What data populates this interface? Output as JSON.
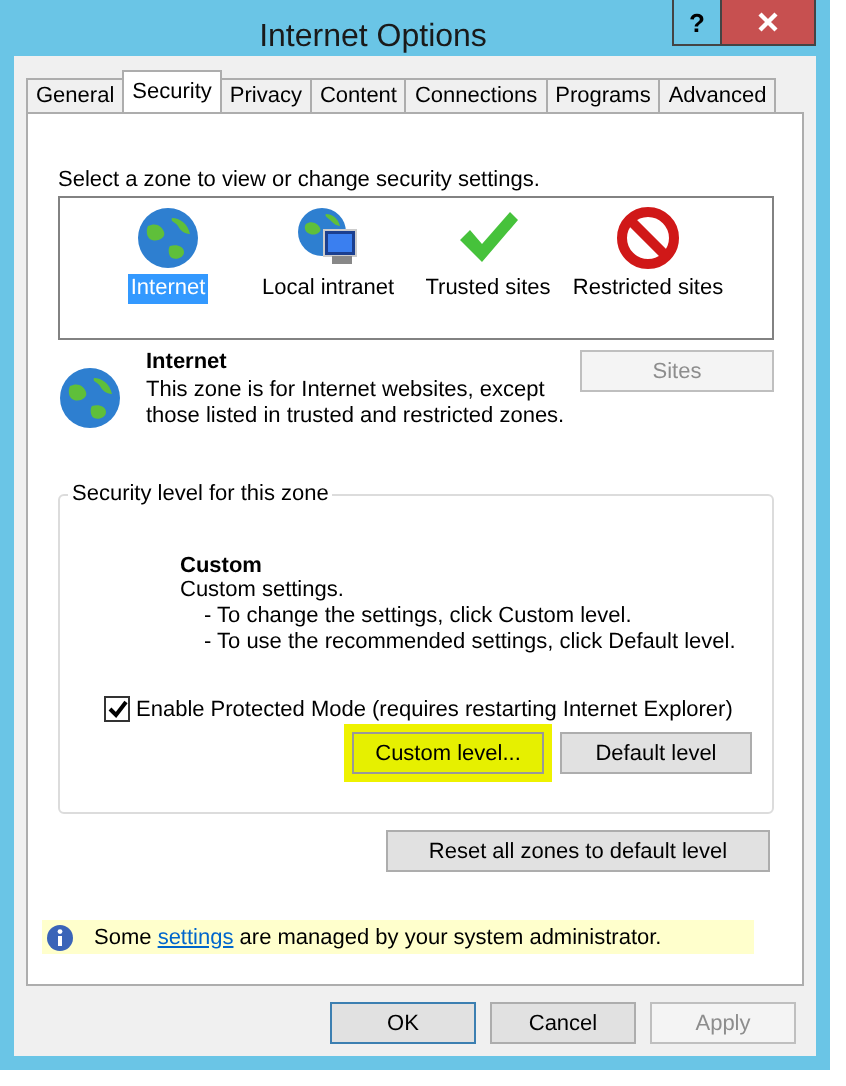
{
  "window": {
    "title": "Internet Options",
    "help_button": "?"
  },
  "tabs": [
    {
      "label": "General",
      "selected": false
    },
    {
      "label": "Security",
      "selected": true
    },
    {
      "label": "Privacy",
      "selected": false
    },
    {
      "label": "Content",
      "selected": false
    },
    {
      "label": "Connections",
      "selected": false
    },
    {
      "label": "Programs",
      "selected": false
    },
    {
      "label": "Advanced",
      "selected": false
    }
  ],
  "zone_prompt": "Select a zone to view or change security settings.",
  "zones": [
    {
      "label": "Internet",
      "kind": "globe",
      "selected": true
    },
    {
      "label": "Local intranet",
      "kind": "intranet",
      "selected": false
    },
    {
      "label": "Trusted sites",
      "kind": "check",
      "selected": false
    },
    {
      "label": "Restricted sites",
      "kind": "blocked",
      "selected": false
    }
  ],
  "zone_details": {
    "name": "Internet",
    "description": "This zone is for Internet websites, except those listed in trusted and restricted zones.",
    "sites_button": {
      "label": "Sites",
      "disabled": true
    }
  },
  "security_level": {
    "legend": "Security level for this zone",
    "level_name": "Custom",
    "lines": [
      "Custom settings.",
      "- To change the settings, click Custom level.",
      "- To use the recommended settings, click Default level."
    ],
    "protected_mode": {
      "label": "Enable Protected Mode (requires restarting Internet Explorer)",
      "checked": true
    },
    "buttons": [
      {
        "label": "Custom level...",
        "highlighted": true
      },
      {
        "label": "Default level",
        "highlighted": false
      }
    ]
  },
  "reset_button": "Reset all zones to default level",
  "info_bar": {
    "before": "Some",
    "link": "settings",
    "after": "are managed by your system administrator."
  },
  "dialog_buttons": [
    {
      "label": "OK",
      "kind": "default",
      "disabled": false
    },
    {
      "label": "Cancel",
      "kind": "normal",
      "disabled": false
    },
    {
      "label": "Apply",
      "kind": "normal",
      "disabled": true
    }
  ]
}
